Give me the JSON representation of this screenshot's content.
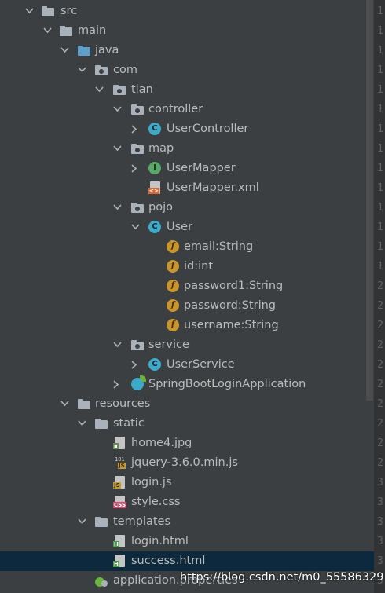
{
  "tree": {
    "items": [
      {
        "label": "src",
        "icon": "folder-icon",
        "expanded": true
      },
      {
        "label": "main",
        "icon": "folder-icon",
        "expanded": true
      },
      {
        "label": "java",
        "icon": "source-folder-icon",
        "expanded": true
      },
      {
        "label": "com",
        "icon": "package-icon",
        "expanded": true
      },
      {
        "label": "tian",
        "icon": "package-icon",
        "expanded": true
      },
      {
        "label": "controller",
        "icon": "package-icon",
        "expanded": true
      },
      {
        "label": "UserController",
        "icon": "class-icon",
        "expanded": false
      },
      {
        "label": "map",
        "icon": "package-icon",
        "expanded": true
      },
      {
        "label": "UserMapper",
        "icon": "interface-icon",
        "expanded": false
      },
      {
        "label": "UserMapper.xml",
        "icon": "xml-file-icon"
      },
      {
        "label": "pojo",
        "icon": "package-icon",
        "expanded": true
      },
      {
        "label": "User",
        "icon": "class-icon",
        "expanded": true
      },
      {
        "label": "email:String",
        "icon": "field-icon"
      },
      {
        "label": "id:int",
        "icon": "field-icon"
      },
      {
        "label": "password1:String",
        "icon": "field-icon"
      },
      {
        "label": "password:String",
        "icon": "field-icon"
      },
      {
        "label": "username:String",
        "icon": "field-icon"
      },
      {
        "label": "service",
        "icon": "package-icon",
        "expanded": true
      },
      {
        "label": "UserService",
        "icon": "class-icon",
        "expanded": false
      },
      {
        "label": "SpringBootLoginApplication",
        "icon": "spring-boot-class-icon",
        "expanded": false
      },
      {
        "label": "resources",
        "icon": "resources-folder-icon",
        "expanded": true
      },
      {
        "label": "static",
        "icon": "folder-icon",
        "expanded": true
      },
      {
        "label": "home4.jpg",
        "icon": "image-file-icon"
      },
      {
        "label": "jquery-3.6.0.min.js",
        "icon": "minified-js-file-icon"
      },
      {
        "label": "login.js",
        "icon": "js-file-icon"
      },
      {
        "label": "style.css",
        "icon": "css-file-icon"
      },
      {
        "label": "templates",
        "icon": "folder-icon",
        "expanded": true
      },
      {
        "label": "login.html",
        "icon": "html-file-icon"
      },
      {
        "label": "success.html",
        "icon": "html-file-icon",
        "selected": true
      },
      {
        "label": "application.properties",
        "icon": "properties-file-icon"
      }
    ]
  },
  "icon_text": {
    "class": "C",
    "interface": "I",
    "field": "f",
    "xml": "<>",
    "js": "JS",
    "css": "CSS",
    "html": "H",
    "jpg": "▪",
    "binary": "101"
  },
  "gutter": {
    "line_numbers": [
      "1",
      "1",
      "1",
      "1",
      "1",
      "1",
      "1",
      "1",
      "1",
      "1",
      "1",
      "1",
      "1",
      "1",
      "2",
      "2",
      "2",
      "2",
      "2",
      "2",
      "2",
      "2",
      "2",
      "2",
      "3",
      "3",
      "3",
      "3",
      "3",
      "3"
    ]
  },
  "watermark": "https://blog.csdn.net/m0_55586329",
  "colors": {
    "background": "#3c3f41",
    "selected_row": "#0d293e",
    "class": "#3fa9c9",
    "interface": "#59a869",
    "field": "#c9952e"
  }
}
